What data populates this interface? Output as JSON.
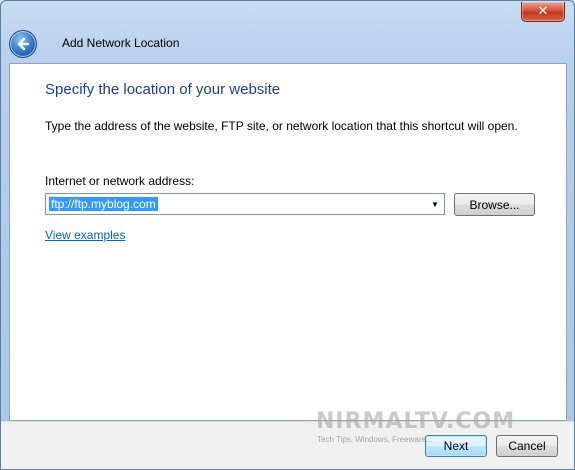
{
  "window": {
    "title": "Add Network Location",
    "close_glyph": "✕"
  },
  "content": {
    "heading": "Specify the location of your website",
    "description": "Type the address of the website, FTP site, or network location that this shortcut will open.",
    "address_label": "Internet or network address:",
    "address_value": "ftp://ftp.myblog.com",
    "browse_label": "Browse...",
    "examples_link": "View examples"
  },
  "footer": {
    "next_label": "Next",
    "cancel_label": "Cancel"
  },
  "watermark": {
    "title": "NIRMALTV.COM",
    "subtitle": "Tech Tips, Windows, Freeware..."
  },
  "icons": {
    "back": "back-arrow-icon",
    "dropdown": "chevron-down-icon"
  },
  "colors": {
    "heading": "#1e3f8a",
    "link": "#0066cc",
    "selection": "#3399ff",
    "close": "#c0371f"
  }
}
